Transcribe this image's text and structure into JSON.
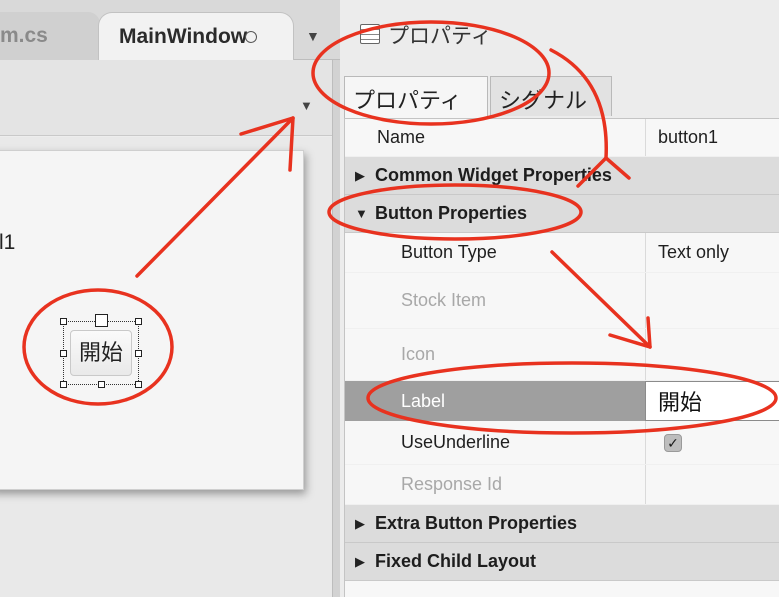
{
  "tabs": {
    "inactive_label": "m.cs",
    "active_label": "MainWindow",
    "overflow_icon": "chevron-down-icon"
  },
  "toolbar": {
    "menu_icon": "triangle-down-icon"
  },
  "designer": {
    "label_fragment": "l1",
    "button_text": "開始"
  },
  "panel": {
    "title": "プロパティ",
    "icon": "property-list-icon",
    "tabs": [
      "プロパティ",
      "シグナル"
    ]
  },
  "properties": {
    "name_row": {
      "name": "Name",
      "value": "button1"
    },
    "group_common": "Common Widget Properties",
    "group_button": "Button Properties",
    "button_type": {
      "name": "Button Type",
      "value": "Text only"
    },
    "stock_item": {
      "name": "Stock Item"
    },
    "icon": {
      "name": "Icon"
    },
    "label": {
      "name": "Label",
      "value": "開始"
    },
    "use_underline": {
      "name": "UseUnderline",
      "checked": true,
      "check_glyph": "✓"
    },
    "response_id": {
      "name": "Response Id"
    },
    "group_extra": "Extra Button Properties",
    "group_fixed": "Fixed Child Layout"
  },
  "colors": {
    "annotation_red": "#e8321f",
    "selected_row": "#9f9f9f",
    "group_row": "#dcdcdc"
  }
}
